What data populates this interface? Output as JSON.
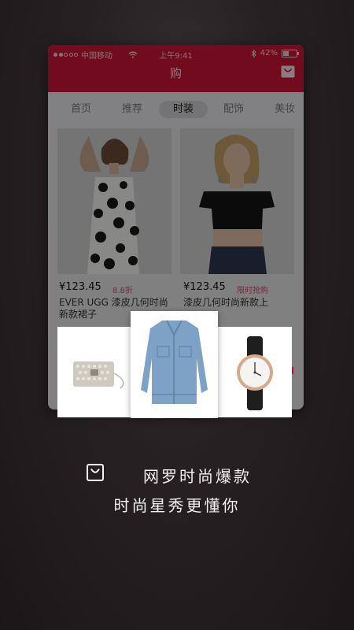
{
  "status": {
    "carrier": "中国移动",
    "time": "上午9:41",
    "battery_percent": "42%",
    "battery_level": 0.42
  },
  "header": {
    "title": "购",
    "bag_icon": "shopping-bag-icon"
  },
  "tabs": [
    {
      "label": "首页",
      "active": false
    },
    {
      "label": "推荐",
      "active": false
    },
    {
      "label": "时装",
      "active": true
    },
    {
      "label": "配饰",
      "active": false
    },
    {
      "label": "美妆",
      "active": false
    }
  ],
  "products": [
    {
      "price": "¥123.45",
      "badge": "8.8折",
      "name": "EVER UGG 漆皮几何时尚新款裙子"
    },
    {
      "price": "¥123.45",
      "badge": "限时抢购",
      "name": "漆皮几何时尚新款上"
    }
  ],
  "showcase": [
    "crystal-clutch-bag",
    "denim-jacket",
    "leather-strap-watch"
  ],
  "tagline": {
    "line1": "网罗时尚爆款",
    "line2": "时尚星秀更懂你"
  },
  "colors": {
    "brand_red": "#cf1538",
    "badge_pink": "#d84a68"
  }
}
